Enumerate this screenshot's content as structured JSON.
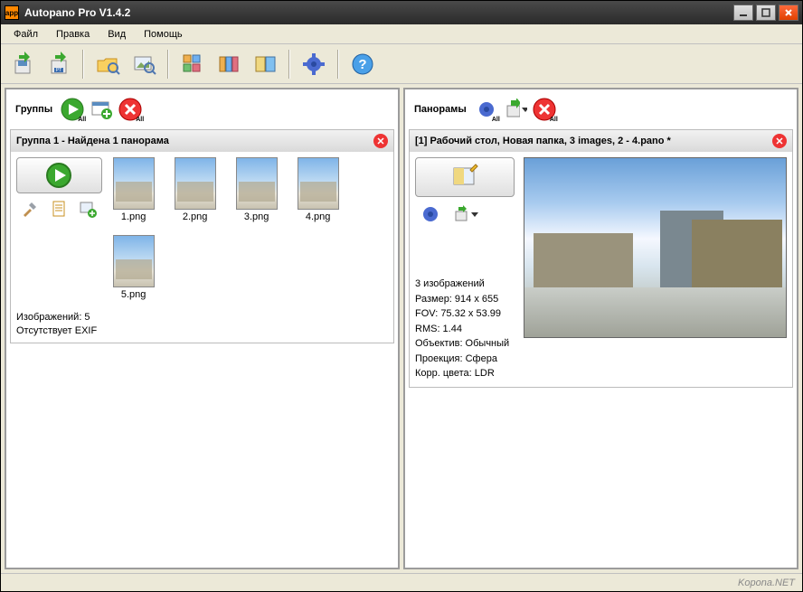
{
  "app": {
    "title": "Autopano Pro V1.4.2"
  },
  "menu": {
    "file": "Файл",
    "edit": "Правка",
    "view": "Вид",
    "help": "Помощь"
  },
  "panes": {
    "groups": {
      "title": "Группы"
    },
    "panoramas": {
      "title": "Панорамы"
    }
  },
  "all_suffix": "All",
  "group": {
    "header": "Группа 1 - Найдена 1 панорама",
    "thumbs": [
      "1.png",
      "2.png",
      "3.png",
      "4.png",
      "5.png"
    ],
    "footer1": "Изображений: 5",
    "footer2": "Отсутствует EXIF"
  },
  "pano": {
    "header": "[1] Рабочий стол, Новая папка, 3 images, 2 - 4.pano *",
    "meta": [
      "3 изображений",
      "Размер: 914 x 655",
      "FOV: 75.32 x 53.99",
      "RMS: 1.44",
      "Объектив: Обычный",
      "Проекция: Сфера",
      "Корр. цвета: LDR"
    ]
  },
  "status": "Kopona.NET"
}
